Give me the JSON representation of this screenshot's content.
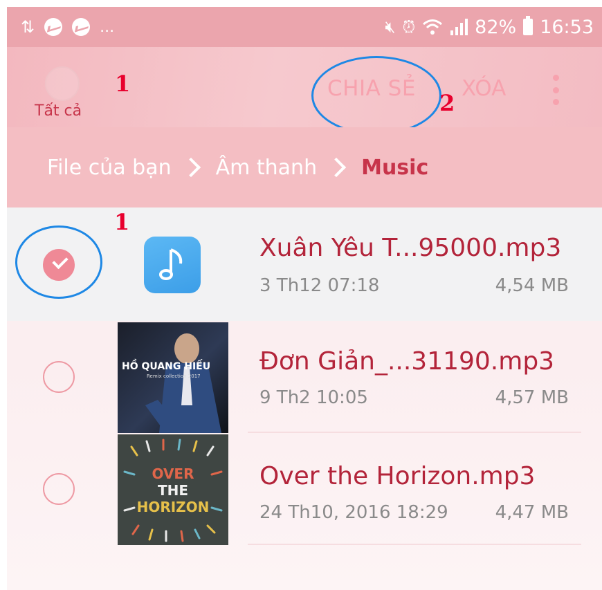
{
  "status_bar": {
    "left_icons": [
      "data-transfer-icon",
      "messenger-icon",
      "messenger-icon",
      "more-notifications-icon"
    ],
    "more_notifications": "...",
    "battery": "82%",
    "time": "16:53"
  },
  "action_bar": {
    "select_all_label": "Tất cả",
    "share_label": "CHIA SẺ",
    "delete_label": "XÓA"
  },
  "annotations": {
    "step1_top": "1",
    "step2": "2",
    "step1_list": "1"
  },
  "breadcrumb": [
    "File của bạn",
    "Âm thanh",
    "Music"
  ],
  "files": [
    {
      "name": "Xuân Yêu T...95000.mp3",
      "date": "3 Th12 07:18",
      "size": "4,54 MB",
      "selected": true,
      "thumb": "music-note-icon"
    },
    {
      "name": "Đơn Giản_...31190.mp3",
      "date": "9 Th2 10:05",
      "size": "4,57 MB",
      "selected": false,
      "thumb": "album-cover",
      "cover_text": [
        "HỒ QUANG HIẾU",
        "Remix collection 2017"
      ]
    },
    {
      "name": "Over the Horizon.mp3",
      "date": "24 Th10, 2016 18:29",
      "size": "4,47 MB",
      "selected": false,
      "thumb": "album-cover",
      "cover_text": [
        "OVER",
        "THE",
        "HORIZON"
      ]
    }
  ],
  "colors": {
    "accent": "#c7344a",
    "status_bar": "#eba5ad",
    "annotation_ring": "#1e88e5",
    "annotation_number": "#e8002d"
  }
}
